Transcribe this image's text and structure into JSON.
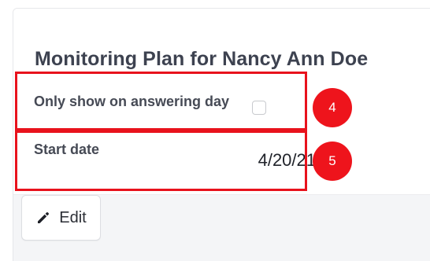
{
  "card": {
    "title": "Monitoring Plan for Nancy Ann Doe",
    "rows": [
      {
        "label": "Only show on answering day",
        "checked": false
      },
      {
        "label": "Start date",
        "value": "4/20/21"
      }
    ]
  },
  "annotations": [
    {
      "number": "4",
      "color": "#ee141c"
    },
    {
      "number": "5",
      "color": "#ee141c"
    }
  ],
  "footer": {
    "edit_button": {
      "label": "Edit",
      "icon": "pencil-icon"
    }
  }
}
